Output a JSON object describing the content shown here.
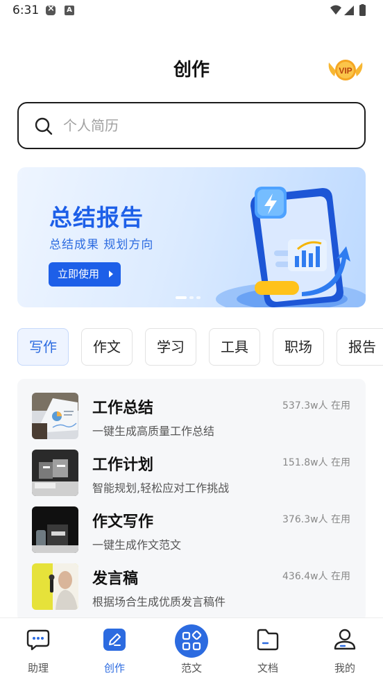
{
  "status_bar": {
    "time": "6:31",
    "icon_a_letter": "A",
    "icons": [
      "shield-icon",
      "a-icon",
      "wifi-icon",
      "signal-icon",
      "battery-icon"
    ]
  },
  "header": {
    "title": "创作",
    "vip_label": "VIP"
  },
  "search": {
    "placeholder": "个人简历"
  },
  "banner": {
    "title": "总结报告",
    "subtitle": "总结成果 规划方向",
    "button_label": "立即使用",
    "slide_count": 3,
    "active_slide": 0
  },
  "category_tabs": [
    {
      "label": "写作",
      "active": true
    },
    {
      "label": "作文",
      "active": false
    },
    {
      "label": "学习",
      "active": false
    },
    {
      "label": "工具",
      "active": false
    },
    {
      "label": "职场",
      "active": false
    },
    {
      "label": "报告",
      "active": false
    }
  ],
  "templates": [
    {
      "title": "工作总结",
      "description": "一键生成高质量工作总结",
      "usage": "537.3w人 在用"
    },
    {
      "title": "工作计划",
      "description": "智能规划,轻松应对工作挑战",
      "usage": "151.8w人 在用"
    },
    {
      "title": "作文写作",
      "description": "一键生成作文范文",
      "usage": "376.3w人 在用"
    },
    {
      "title": "发言稿",
      "description": "根据场合生成优质发言稿件",
      "usage": "436.4w人 在用"
    }
  ],
  "bottom_nav": [
    {
      "label": "助理",
      "icon": "chat-icon",
      "active": false
    },
    {
      "label": "创作",
      "icon": "edit-icon",
      "active": true
    },
    {
      "label": "范文",
      "icon": "grid-icon",
      "active": false
    },
    {
      "label": "文档",
      "icon": "folder-icon",
      "active": false
    },
    {
      "label": "我的",
      "icon": "profile-icon",
      "active": false
    }
  ],
  "colors": {
    "accent": "#2c6be0",
    "banner_blue": "#1d5fe8",
    "vip_gold": "#f5a623"
  }
}
